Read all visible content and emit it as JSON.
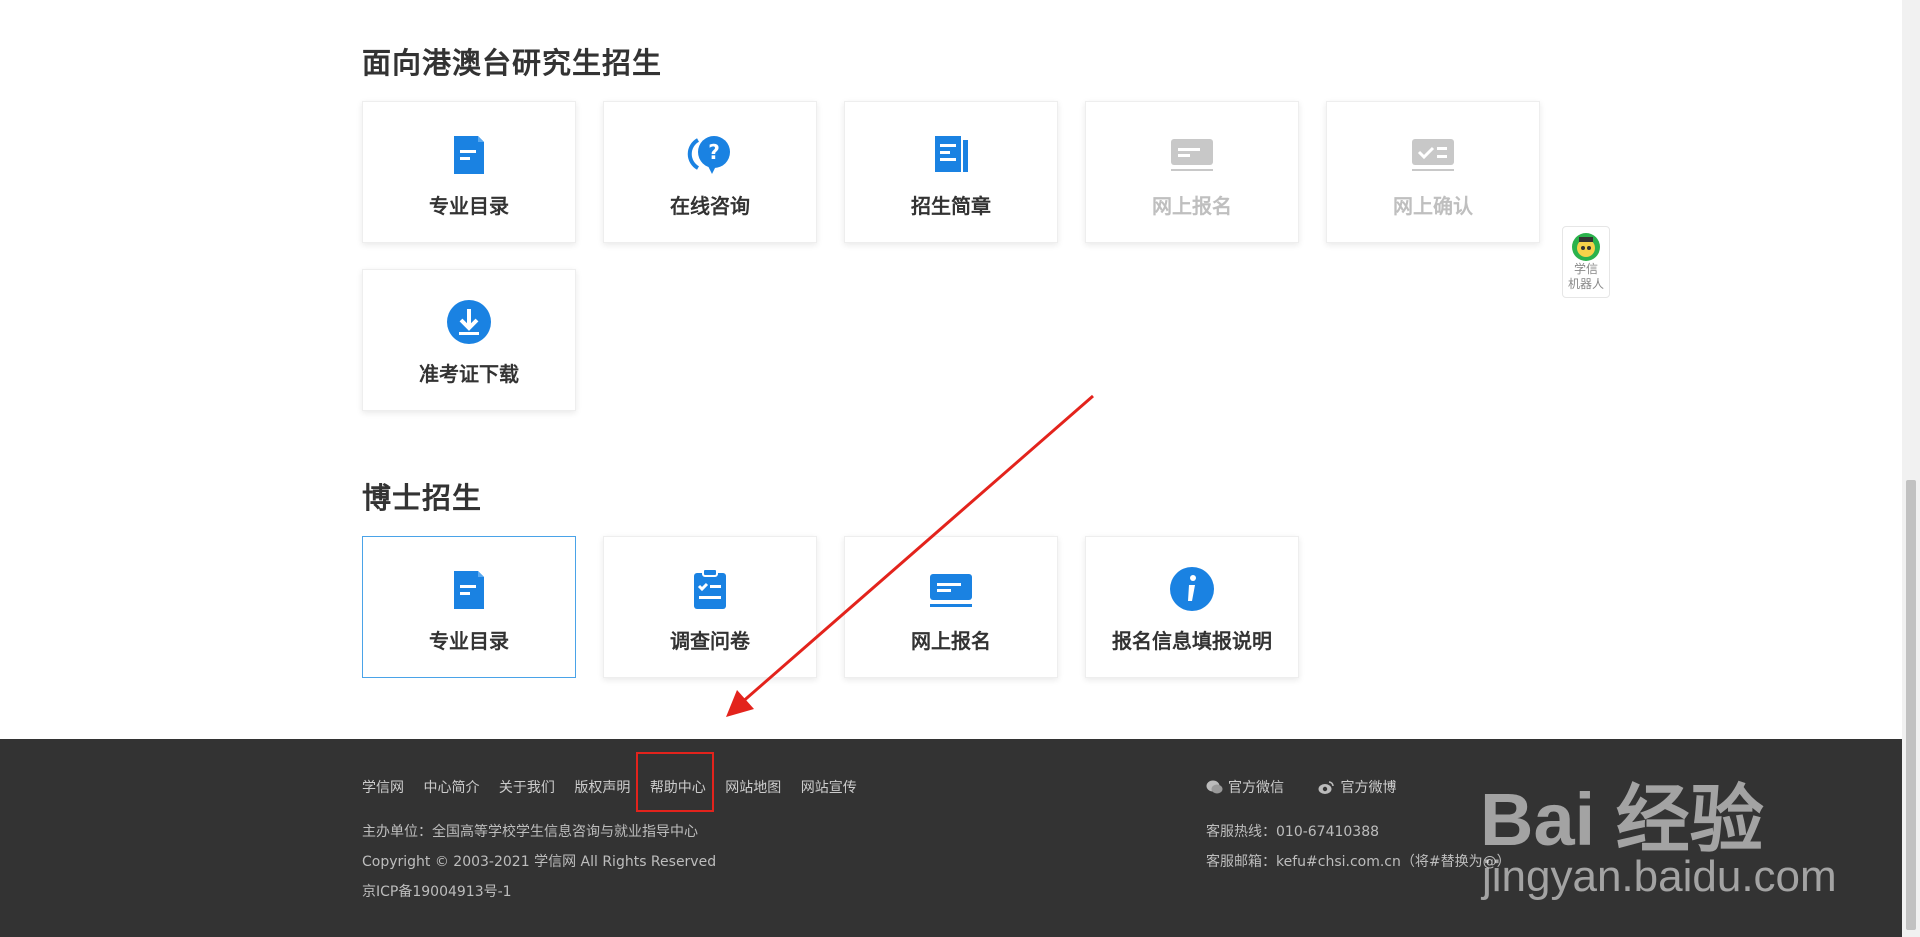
{
  "sections": [
    {
      "title": "面向港澳台研究生招生",
      "cards": [
        {
          "label": "专业目录",
          "icon": "document-icon",
          "state": "active"
        },
        {
          "label": "在线咨询",
          "icon": "question-chat-icon",
          "state": "active"
        },
        {
          "label": "招生简章",
          "icon": "brochure-icon",
          "state": "active"
        },
        {
          "label": "网上报名",
          "icon": "card-icon",
          "state": "disabled"
        },
        {
          "label": "网上确认",
          "icon": "card-check-icon",
          "state": "disabled"
        },
        {
          "label": "准考证下载",
          "icon": "download-icon",
          "state": "active"
        }
      ]
    },
    {
      "title": "博士招生",
      "cards": [
        {
          "label": "专业目录",
          "icon": "document-icon",
          "state": "selected"
        },
        {
          "label": "调查问卷",
          "icon": "clipboard-check-icon",
          "state": "active"
        },
        {
          "label": "网上报名",
          "icon": "monitor-icon",
          "state": "active"
        },
        {
          "label": "报名信息填报说明",
          "icon": "info-icon",
          "state": "active"
        }
      ]
    }
  ],
  "robot": {
    "line1": "学信",
    "line2": "机器人"
  },
  "footer": {
    "links": [
      "学信网",
      "中心简介",
      "关于我们",
      "版权声明",
      "帮助中心",
      "网站地图",
      "网站宣传"
    ],
    "highlighted_link": "帮助中心",
    "sponsor": "主办单位：全国高等学校学生信息咨询与就业指导中心",
    "copyright": "Copyright © 2003-2021 学信网 All Rights Reserved",
    "icp": "京ICP备19004913号-1",
    "wechat": "官方微信",
    "weibo": "官方微博",
    "hotline": "客服热线：010-67410388",
    "email": "客服邮箱：kefu#chsi.com.cn（将#替换为@）"
  },
  "watermark": {
    "brand": "Bai 经验",
    "url": "jingyan.baidu.com"
  },
  "colors": {
    "accent": "#1a82e2",
    "disabled": "#c8c8c8",
    "footer_bg": "#333333",
    "highlight": "#e3231c"
  }
}
